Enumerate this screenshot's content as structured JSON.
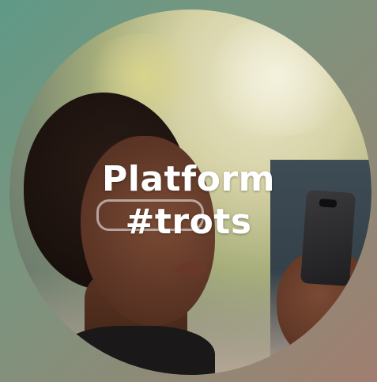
{
  "headline": {
    "line1": "Platform",
    "line2": "#trots"
  },
  "colors": {
    "background_start": "#5e9a87",
    "background_end": "#a17e70",
    "text": "#ffffff"
  }
}
